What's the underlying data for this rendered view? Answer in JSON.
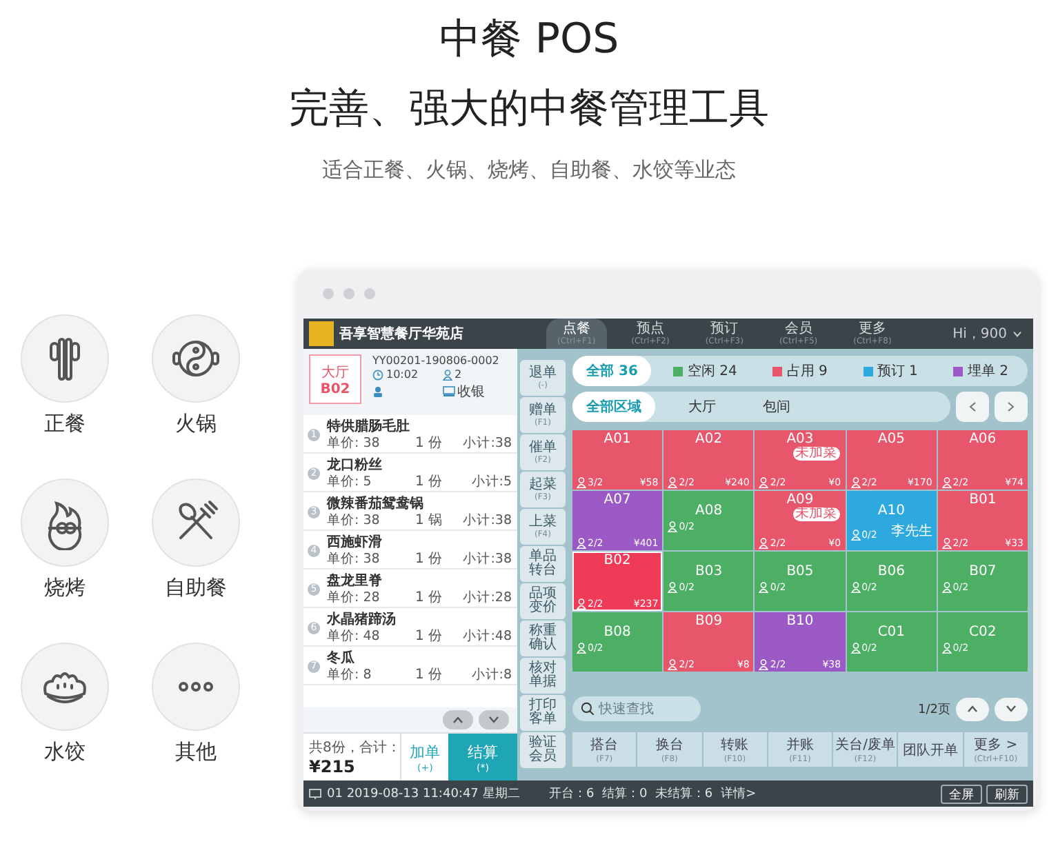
{
  "header": {
    "title": "中餐 POS",
    "subtitle": "完善、强大的中餐管理工具",
    "tagline": "适合正餐、火锅、烧烤、自助餐、水饺等业态"
  },
  "categories": [
    {
      "label": "正餐",
      "kind": "chopsticks"
    },
    {
      "label": "火锅",
      "kind": "hotpot"
    },
    {
      "label": "烧烤",
      "kind": "bbq"
    },
    {
      "label": "自助餐",
      "kind": "buffet"
    },
    {
      "label": "水饺",
      "kind": "dumpling"
    },
    {
      "label": "其他",
      "kind": "more"
    }
  ],
  "pos": {
    "nav": {
      "store": "吾享智慧餐厅华苑店",
      "user": "Hi，900",
      "tabs": [
        {
          "label": "点餐",
          "shortcut": "(Ctrl+F1)",
          "selected": true
        },
        {
          "label": "预点",
          "shortcut": "(Ctrl+F2)",
          "selected": false
        },
        {
          "label": "预订",
          "shortcut": "(Ctrl+F3)",
          "selected": false
        },
        {
          "label": "会员",
          "shortcut": "(Ctrl+F5)",
          "selected": false
        },
        {
          "label": "更多",
          "shortcut": "(Ctrl+F8)",
          "selected": false
        }
      ]
    },
    "order": {
      "area": "大厅",
      "table": "B02",
      "number": "YY00201-190806-0002",
      "time": "10:02",
      "guests": "2",
      "cashier": "收银",
      "items": [
        {
          "index": "1",
          "name": "特供腊肠毛肚",
          "price": "单价: 38",
          "qty": "1 份",
          "subtotal": "小计:38"
        },
        {
          "index": "2",
          "name": "龙口粉丝",
          "price": "单价: 5",
          "qty": "1 份",
          "subtotal": "小计:5"
        },
        {
          "index": "3",
          "name": "微辣番茄鸳鸯锅",
          "price": "单价: 38",
          "qty": "1 锅",
          "subtotal": "小计:38"
        },
        {
          "index": "4",
          "name": "西施虾滑",
          "price": "单价: 38",
          "qty": "1 份",
          "subtotal": "小计:38"
        },
        {
          "index": "5",
          "name": "盘龙里脊",
          "price": "单价: 28",
          "qty": "1 份",
          "subtotal": "小计:28"
        },
        {
          "index": "6",
          "name": "水晶猪蹄汤",
          "price": "单价: 48",
          "qty": "1 份",
          "subtotal": "小计:48"
        },
        {
          "index": "7",
          "name": "冬瓜",
          "price": "单价: 8",
          "qty": "1 份",
          "subtotal": "小计:8"
        }
      ],
      "total_label": "共8份，合计：",
      "total": "¥215",
      "add": {
        "label": "加单",
        "shortcut": "(+)"
      },
      "pay": {
        "label": "结算",
        "shortcut": "(*)"
      }
    },
    "side_actions": [
      {
        "label": "退单",
        "shortcut": "(-)"
      },
      {
        "label": "赠单",
        "shortcut": "(F1)"
      },
      {
        "label": "催单",
        "shortcut": "(F2)"
      },
      {
        "label": "起菜",
        "shortcut": "(F3)"
      },
      {
        "label": "上菜",
        "shortcut": "(F4)"
      },
      {
        "label": "单品转台"
      },
      {
        "label": "品项变价"
      },
      {
        "label": "称重确认"
      },
      {
        "label": "核对单据"
      },
      {
        "label": "打印客单"
      },
      {
        "label": "验证会员"
      }
    ],
    "filters": [
      {
        "label": "全部 36",
        "selected": true
      },
      {
        "label": "空闲 24",
        "color": "#4caf64",
        "selected": false
      },
      {
        "label": "占用 9",
        "color": "#e8566c",
        "selected": false
      },
      {
        "label": "预订 1",
        "color": "#2ea9e0",
        "selected": false
      },
      {
        "label": "埋单 2",
        "color": "#9b59c6",
        "selected": false
      }
    ],
    "areas": [
      {
        "label": "全部区域",
        "selected": true
      },
      {
        "label": "大厅",
        "selected": false
      },
      {
        "label": "包间",
        "selected": false
      }
    ],
    "tables": [
      {
        "name": "A01",
        "color": "#e8566c",
        "guests": "3/2",
        "amount": "¥58",
        "selected": false
      },
      {
        "name": "A02",
        "color": "#e8566c",
        "guests": "2/2",
        "amount": "¥240",
        "selected": false
      },
      {
        "name": "A03",
        "color": "#e8566c",
        "guests": "2/2",
        "amount": "¥0",
        "tag": "未加菜",
        "selected": false
      },
      {
        "name": "A05",
        "color": "#e8566c",
        "guests": "2/2",
        "amount": "¥170",
        "selected": false
      },
      {
        "name": "A06",
        "color": "#e8566c",
        "guests": "2/2",
        "amount": "¥74",
        "selected": false
      },
      {
        "name": "A07",
        "color": "#9b59c6",
        "guests": "2/2",
        "amount": "¥401",
        "selected": false
      },
      {
        "name": "A08",
        "color": "#4caf64",
        "guests": "0/2",
        "selected": false
      },
      {
        "name": "A09",
        "color": "#e8566c",
        "guests": "2/2",
        "amount": "¥0",
        "tag": "未加菜",
        "selected": false
      },
      {
        "name": "A10",
        "color": "#2ea9e0",
        "guests": "0/2",
        "note": "李先生",
        "selected": false
      },
      {
        "name": "B01",
        "color": "#e8566c",
        "guests": "2/2",
        "amount": "¥33",
        "selected": false
      },
      {
        "name": "B02",
        "color": "#ef3b57",
        "guests": "2/2",
        "amount": "¥237",
        "selected": true
      },
      {
        "name": "B03",
        "color": "#4caf64",
        "guests": "0/2",
        "selected": false
      },
      {
        "name": "B05",
        "color": "#4caf64",
        "guests": "0/2",
        "selected": false
      },
      {
        "name": "B06",
        "color": "#4caf64",
        "guests": "0/2",
        "selected": false
      },
      {
        "name": "B07",
        "color": "#4caf64",
        "guests": "0/2",
        "selected": false
      },
      {
        "name": "B08",
        "color": "#4caf64",
        "guests": "0/2",
        "selected": false
      },
      {
        "name": "B09",
        "color": "#e8566c",
        "guests": "2/2",
        "amount": "¥8",
        "selected": false
      },
      {
        "name": "B10",
        "color": "#9b59c6",
        "guests": "2/2",
        "amount": "¥38",
        "selected": false
      },
      {
        "name": "C01",
        "color": "#4caf64",
        "guests": "0/2",
        "selected": false
      },
      {
        "name": "C02",
        "color": "#4caf64",
        "guests": "0/2",
        "selected": false
      }
    ],
    "search": {
      "placeholder": "快速查找"
    },
    "page": "1/2页",
    "actions": [
      {
        "label": "搭台",
        "shortcut": "(F7)"
      },
      {
        "label": "换台",
        "shortcut": "(F8)"
      },
      {
        "label": "转账",
        "shortcut": "(F10)"
      },
      {
        "label": "并账",
        "shortcut": "(F11)"
      },
      {
        "label": "关台/废单",
        "shortcut": "(F12)"
      },
      {
        "label": "团队开单"
      },
      {
        "label": "更多 >",
        "shortcut": "(Ctrl+F10)"
      }
    ],
    "status_bar": {
      "terminal": "01 2019-08-13 11:40:47 星期二",
      "summary": "开台：6  结算：0  未结算：6",
      "details": "详情>",
      "buttons": [
        "全屏",
        "刷新"
      ]
    }
  }
}
